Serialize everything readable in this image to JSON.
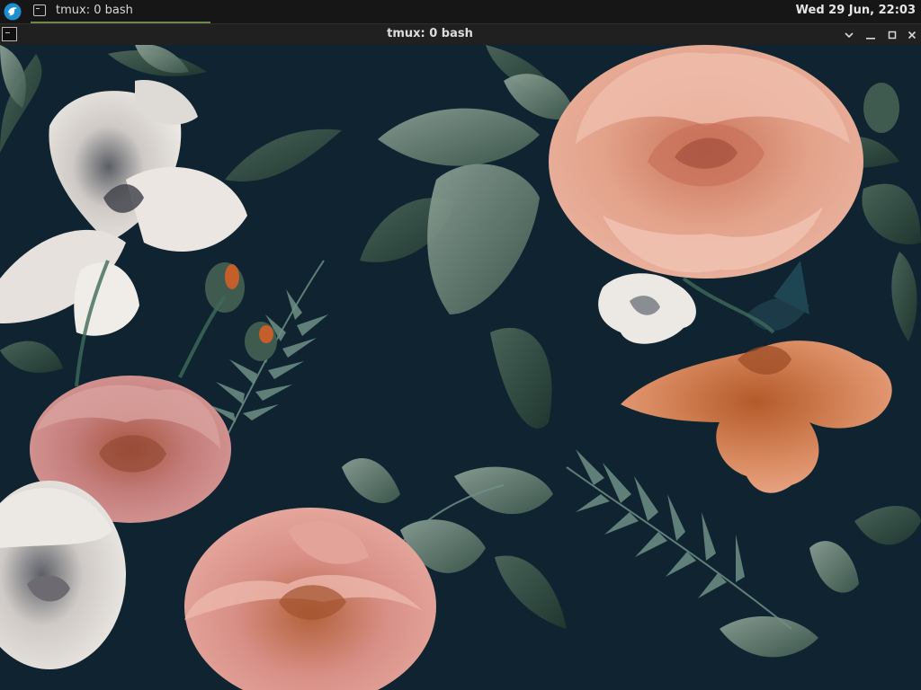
{
  "panel": {
    "task_label": "tmux: 0 bash",
    "clock": "Wed 29 Jun, 22:03"
  },
  "window": {
    "title": "tmux: 0 bash"
  },
  "colors": {
    "wallpaper_bg": "#0f2430",
    "panel_bg": "#161616",
    "titlebar_bg": "#202020",
    "active_task_underline": "#6a8a4a",
    "launcher_blue": "#1e8ed0"
  },
  "icons": {
    "launcher": "distro-launcher-icon",
    "task": "terminal-icon",
    "window": "terminal-icon",
    "controls": [
      "chevron-down-icon",
      "minimize-icon",
      "maximize-icon",
      "close-icon"
    ]
  }
}
